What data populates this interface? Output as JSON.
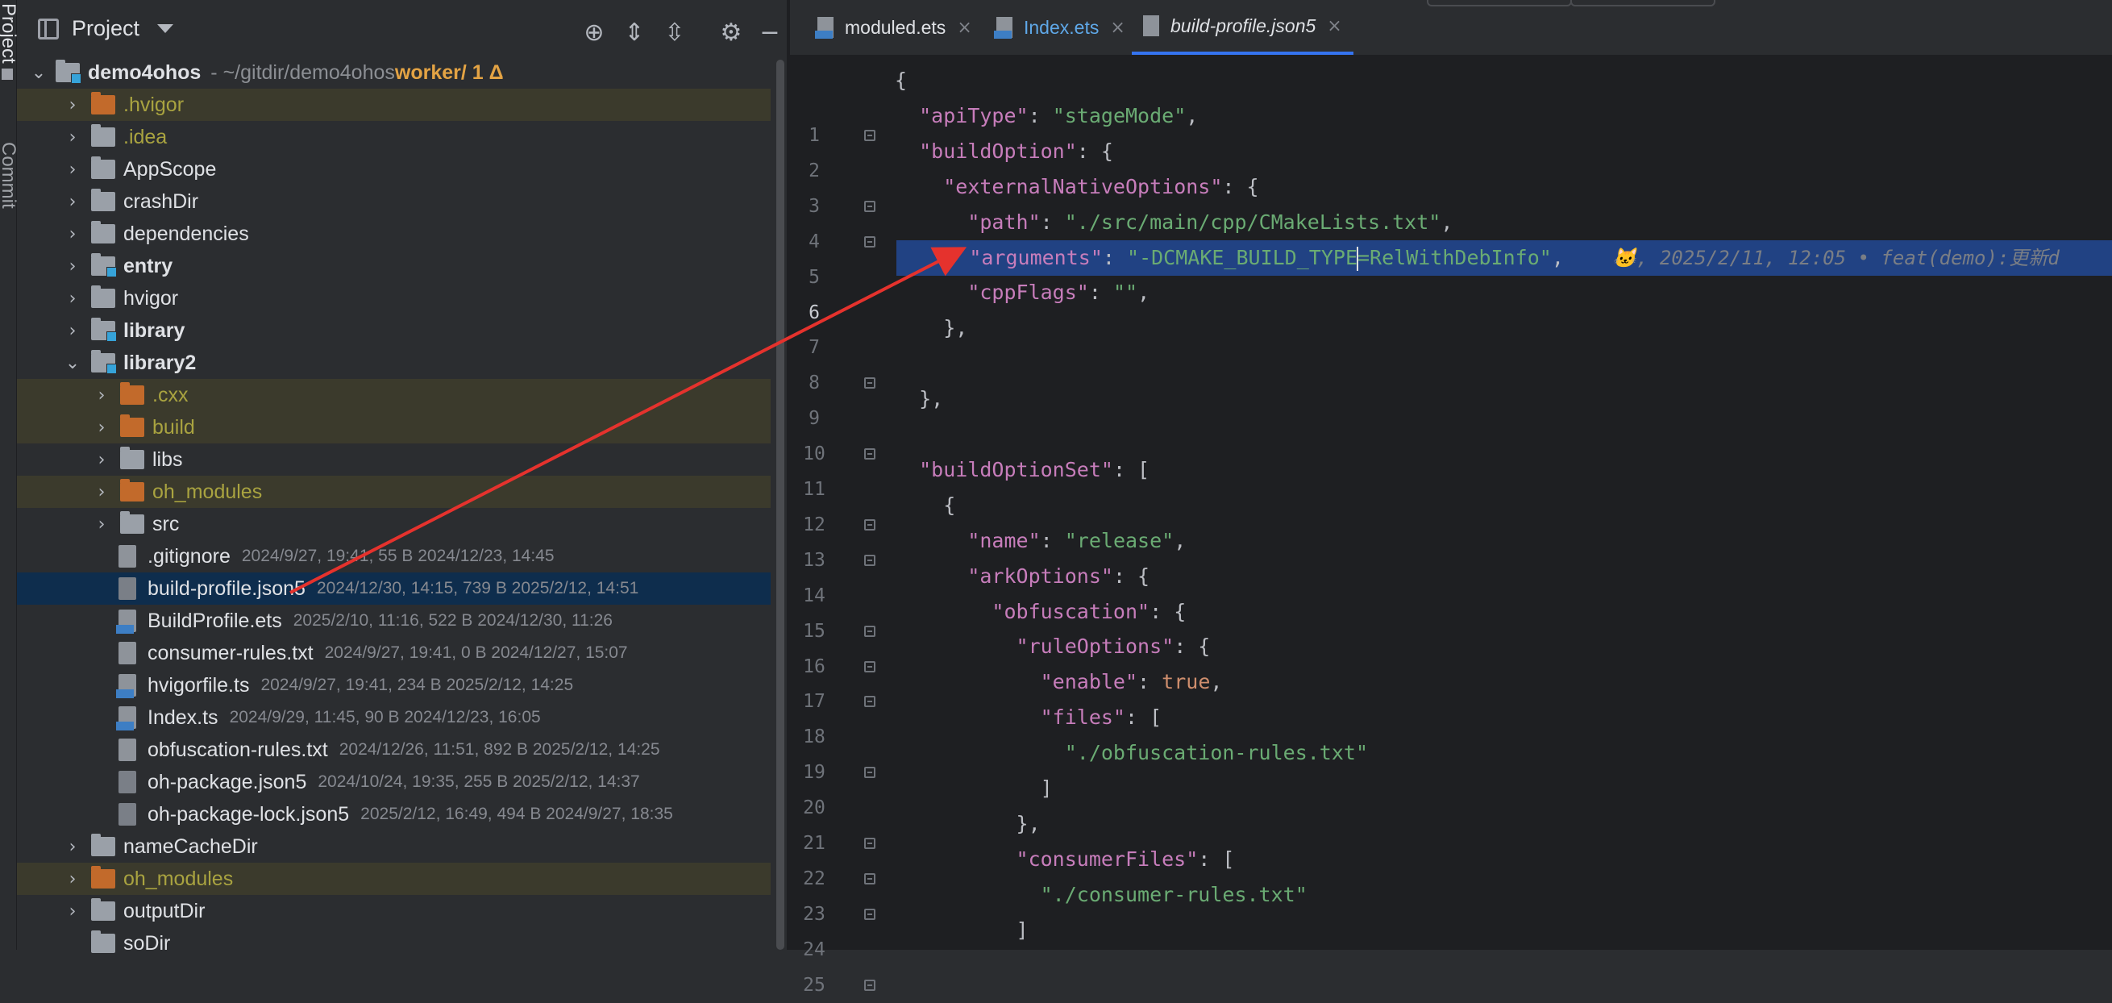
{
  "left_strip": {
    "project_tab": "Project",
    "commit_tab": "Commit"
  },
  "project_panel": {
    "title": "Project",
    "root": {
      "name": "demo4ohos",
      "path": "- ~/gitdir/demo4ohos",
      "branch": "worker/ 1 Δ"
    },
    "tree": [
      {
        "name": ".hvigor",
        "kind": "folder-orange",
        "state": "ignored"
      },
      {
        "name": ".idea",
        "kind": "folder",
        "state": "ignored"
      },
      {
        "name": "AppScope",
        "kind": "folder"
      },
      {
        "name": "crashDir",
        "kind": "folder"
      },
      {
        "name": "dependencies",
        "kind": "folder"
      },
      {
        "name": "entry",
        "kind": "module"
      },
      {
        "name": "hvigor",
        "kind": "folder"
      },
      {
        "name": "library",
        "kind": "module"
      },
      {
        "name": "library2",
        "kind": "module",
        "expanded": true
      },
      {
        "name": ".cxx",
        "kind": "folder-orange",
        "state": "ignored"
      },
      {
        "name": "build",
        "kind": "folder-orange",
        "state": "ignored"
      },
      {
        "name": "libs",
        "kind": "folder"
      },
      {
        "name": "oh_modules",
        "kind": "folder-orange",
        "state": "ignored"
      },
      {
        "name": "src",
        "kind": "folder"
      },
      {
        "name": ".gitignore",
        "kind": "file",
        "meta": "2024/9/27, 19:41, 55 B 2024/12/23, 14:45"
      },
      {
        "name": "build-profile.json5",
        "kind": "json",
        "meta": "2024/12/30, 14:15, 739 B 2025/2/12, 14:51",
        "state": "selected"
      },
      {
        "name": "BuildProfile.ets",
        "kind": "ets",
        "meta": "2025/2/10, 11:16, 522 B 2024/12/30, 11:26"
      },
      {
        "name": "consumer-rules.txt",
        "kind": "file",
        "meta": "2024/9/27, 19:41, 0 B 2024/12/27, 15:07"
      },
      {
        "name": "hvigorfile.ts",
        "kind": "ts",
        "meta": "2024/9/27, 19:41, 234 B 2025/2/12, 14:25"
      },
      {
        "name": "Index.ts",
        "kind": "ts",
        "meta": "2024/9/29, 11:45, 90 B 2024/12/23, 16:05"
      },
      {
        "name": "obfuscation-rules.txt",
        "kind": "file",
        "meta": "2024/12/26, 11:51, 892 B 2025/2/12, 14:25"
      },
      {
        "name": "oh-package.json5",
        "kind": "json",
        "meta": "2024/10/24, 19:35, 255 B 2025/2/12, 14:37"
      },
      {
        "name": "oh-package-lock.json5",
        "kind": "json",
        "meta": "2025/2/12, 16:49, 494 B 2024/9/27, 18:35"
      },
      {
        "name": "nameCacheDir",
        "kind": "folder"
      },
      {
        "name": "oh_modules",
        "kind": "folder-orange",
        "state": "ignored"
      },
      {
        "name": "outputDir",
        "kind": "folder"
      },
      {
        "name": "soDir",
        "kind": "folder"
      }
    ]
  },
  "editor": {
    "tabs": [
      {
        "label": "moduled.ets",
        "active": false
      },
      {
        "label": "Index.ets",
        "active": false
      },
      {
        "label": "build-profile.json5",
        "active": true
      }
    ],
    "current_line": 6,
    "lines": [
      "{",
      "  \"apiType\": \"stageMode\",",
      "  \"buildOption\": {",
      "    \"externalNativeOptions\": {",
      "      \"path\": \"./src/main/cpp/CMakeLists.txt\",",
      "      \"arguments\": \"-DCMAKE_BUILD_TYPE=RelWithDebInfo\",",
      "      \"cppFlags\": \"\",",
      "    },",
      "",
      "  },",
      "",
      "  \"buildOptionSet\": [",
      "    {",
      "      \"name\": \"release\",",
      "      \"arkOptions\": {",
      "        \"obfuscation\": {",
      "          \"ruleOptions\": {",
      "            \"enable\": true,",
      "            \"files\": [",
      "              \"./obfuscation-rules.txt\"",
      "            ]",
      "          },",
      "          \"consumerFiles\": [",
      "            \"./consumer-rules.txt\"",
      "          ]"
    ],
    "blame": "🐱, 2025/2/11, 12:05 • feat(demo):更新d"
  }
}
